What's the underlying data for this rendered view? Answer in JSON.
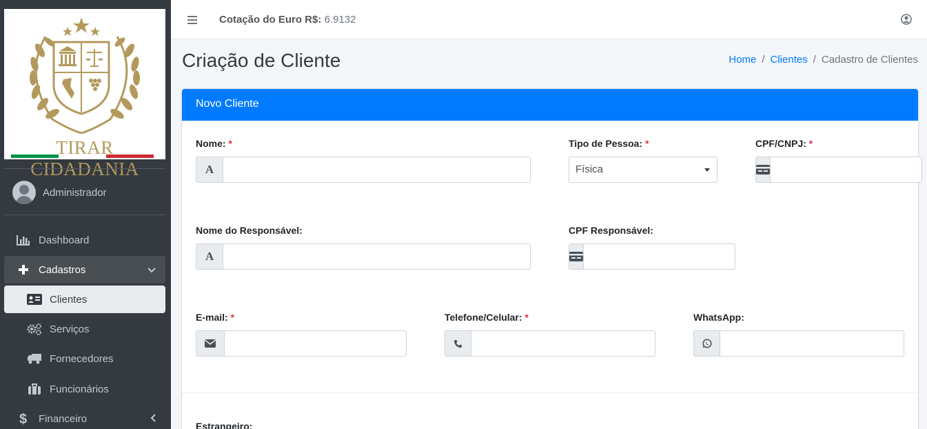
{
  "brand": {
    "name": "TIRAR CIDADANIA",
    "flag_colors": [
      "#009246",
      "#ffffff",
      "#ce2b37"
    ],
    "gold_color": "#b39a5c"
  },
  "sidebar": {
    "user_name": "Administrador",
    "items": [
      {
        "label": "Dashboard",
        "icon": "bar-chart-icon"
      },
      {
        "label": "Cadastros",
        "icon": "plus-icon",
        "expanded": true
      },
      {
        "label": "Clientes",
        "icon": "address-card-icon",
        "active": true
      },
      {
        "label": "Serviços",
        "icon": "cogs-icon"
      },
      {
        "label": "Fornecedores",
        "icon": "truck-icon"
      },
      {
        "label": "Funcionários",
        "icon": "briefcase-icon"
      },
      {
        "label": "Financeiro",
        "icon": "dollar-icon"
      }
    ]
  },
  "header": {
    "euro_label": "Cotação do Euro R$:",
    "euro_value": "6.9132"
  },
  "page": {
    "title": "Criação de Cliente",
    "breadcrumb": [
      "Home",
      "Clientes",
      "Cadastro de Clientes"
    ]
  },
  "card": {
    "title": "Novo Cliente",
    "accent_color": "#007bff"
  },
  "form": {
    "nome_label": "Nome:",
    "tipo_pessoa_label": "Tipo de Pessoa:",
    "tipo_pessoa_value": "Física",
    "cpf_cnpj_label": "CPF/CNPJ:",
    "nome_responsavel_label": "Nome do Responsável:",
    "cpf_responsavel_label": "CPF Responsável:",
    "email_label": "E-mail:",
    "telefone_label": "Telefone/Celular:",
    "whatsapp_label": "WhatsApp:",
    "estrangeiro_label": "Estrangeiro:",
    "required_mark": "*",
    "text_icon_glyph": "A"
  }
}
